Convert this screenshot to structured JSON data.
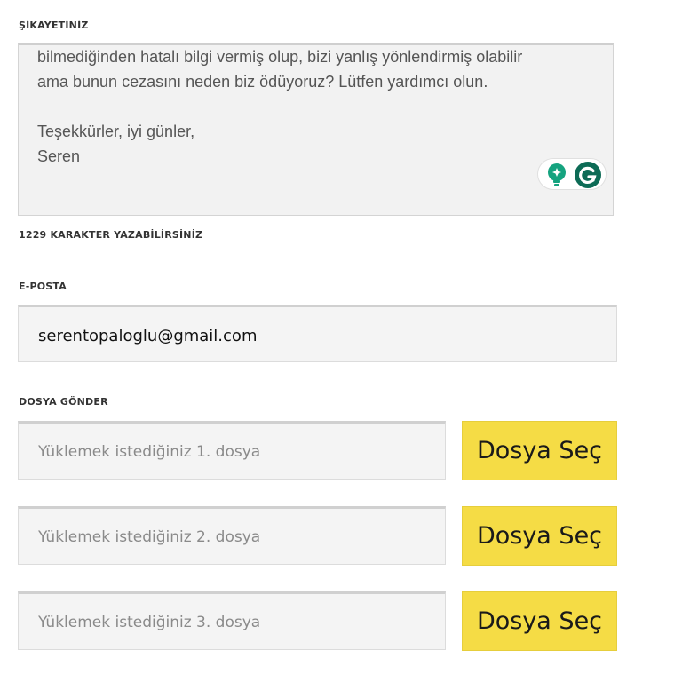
{
  "complaint": {
    "label": "ŞİKAYETİNİZ",
    "text": "bilmediğinden hatalı bilgi vermiş olup, bizi yanlış yönlendirmiş olabilir\nama bunun cezasını neden biz ödüyoruz? Lütfen yardımcı olun.\n\nTeşekkürler, iyi günler,\nSeren",
    "char_counter": "1229 KARAKTER YAZABİLİRSİNİZ"
  },
  "email": {
    "label": "E-POSTA",
    "value": "serentopaloglu@gmail.com"
  },
  "files": {
    "label": "DOSYA GÖNDER",
    "items": [
      {
        "placeholder": "Yüklemek istediğiniz 1. dosya",
        "button": "Dosya Seç"
      },
      {
        "placeholder": "Yüklemek istediğiniz 2. dosya",
        "button": "Dosya Seç"
      },
      {
        "placeholder": "Yüklemek istediğiniz 3. dosya",
        "button": "Dosya Seç"
      }
    ]
  },
  "colors": {
    "button_bg": "#f5dc45",
    "grammarly_green": "#15a37f",
    "grammarly_dark": "#0d6b56"
  },
  "icons": {
    "bulb": "lightbulb-icon",
    "grammarly": "grammarly-icon"
  }
}
